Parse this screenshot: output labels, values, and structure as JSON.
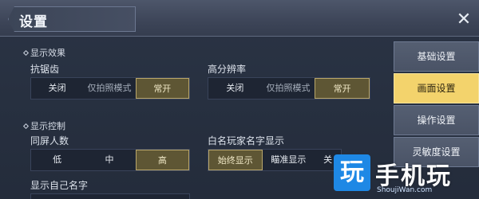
{
  "title": "设置",
  "close_icon": "close-icon",
  "sections": {
    "display_effect": {
      "title": "显示效果",
      "antialias": {
        "label": "抗锯齿",
        "options": [
          "关闭",
          "仅拍照模式",
          "常开"
        ],
        "selected": 2
      },
      "hires": {
        "label": "高分辨率",
        "options": [
          "关闭",
          "仅拍照模式",
          "常开"
        ],
        "selected": 2
      }
    },
    "display_control": {
      "title": "显示控制",
      "same_screen": {
        "label": "同屏人数",
        "options": [
          "低",
          "中",
          "高"
        ],
        "selected": 2
      },
      "white_name": {
        "label": "白名玩家名字显示",
        "options": [
          "始终显示",
          "瞄准显示",
          "关"
        ],
        "selected": 0
      },
      "show_own_name": {
        "label": "显示自己名字"
      }
    }
  },
  "sidebar": {
    "items": [
      {
        "label": "基础设置"
      },
      {
        "label": "画面设置"
      },
      {
        "label": "操作设置"
      },
      {
        "label": "灵敏度设置"
      }
    ],
    "active_index": 1
  },
  "watermark": {
    "mark": "玩",
    "text": "手机玩",
    "url": "ShoujiWan.com"
  },
  "colors": {
    "accent": "#f3d36c",
    "selected_option": "#5e5634",
    "watermark": "#1e88e5"
  }
}
